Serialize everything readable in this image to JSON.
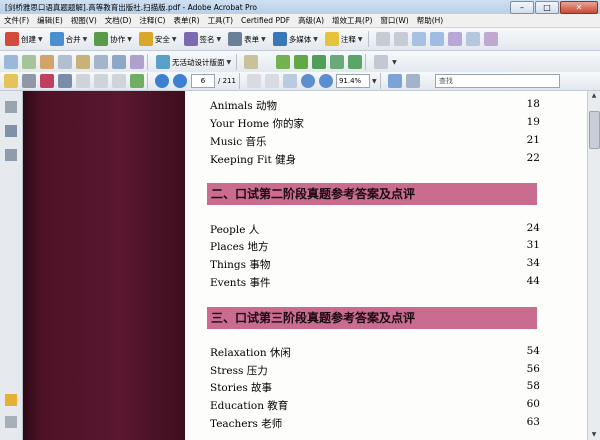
{
  "window": {
    "title": "[剑桥雅思口语真题题解].高等教育出版社.扫描版.pdf - Adobe Acrobat Pro",
    "minimize": "–",
    "maximize": "□",
    "close": "✕"
  },
  "menu": [
    "文件(F)",
    "编辑(E)",
    "视图(V)",
    "文档(D)",
    "注释(C)",
    "表单(R)",
    "工具(T)",
    "Certified PDF",
    "高级(A)",
    "增效工具(P)",
    "窗口(W)",
    "帮助(H)"
  ],
  "toolbar1": {
    "create": "创建",
    "combine": "合并",
    "collaborate": "协作",
    "secure": "安全",
    "sign": "签名",
    "forms": "表单",
    "multimedia": "多媒体",
    "comment": "注释"
  },
  "toolbar2": {
    "dropdown_label": "无活动设计版面"
  },
  "nav": {
    "page_current": "6",
    "page_total": "/ 211",
    "zoom": "91.4%",
    "find_placeholder": "查找"
  },
  "document": {
    "entries_top": [
      {
        "label": "Animals 动物",
        "page": "18"
      },
      {
        "label": "Your Home 你的家",
        "page": "19"
      },
      {
        "label": "Music 音乐",
        "page": "21"
      },
      {
        "label": "Keeping Fit 健身",
        "page": "22"
      }
    ],
    "section2": "二、口试第二阶段真题参考答案及点评",
    "entries_mid": [
      {
        "label": "People 人",
        "page": "24"
      },
      {
        "label": "Places 地方",
        "page": "31"
      },
      {
        "label": "Things 事物",
        "page": "34"
      },
      {
        "label": "Events 事件",
        "page": "44"
      }
    ],
    "section3": "三、口试第三阶段真题参考答案及点评",
    "entries_bottom": [
      {
        "label": "Relaxation 休闲",
        "page": "54"
      },
      {
        "label": "Stress 压力",
        "page": "56"
      },
      {
        "label": "Stories 故事",
        "page": "58"
      },
      {
        "label": "Education 教育",
        "page": "60"
      },
      {
        "label": "Teachers 老师",
        "page": "63"
      }
    ]
  }
}
